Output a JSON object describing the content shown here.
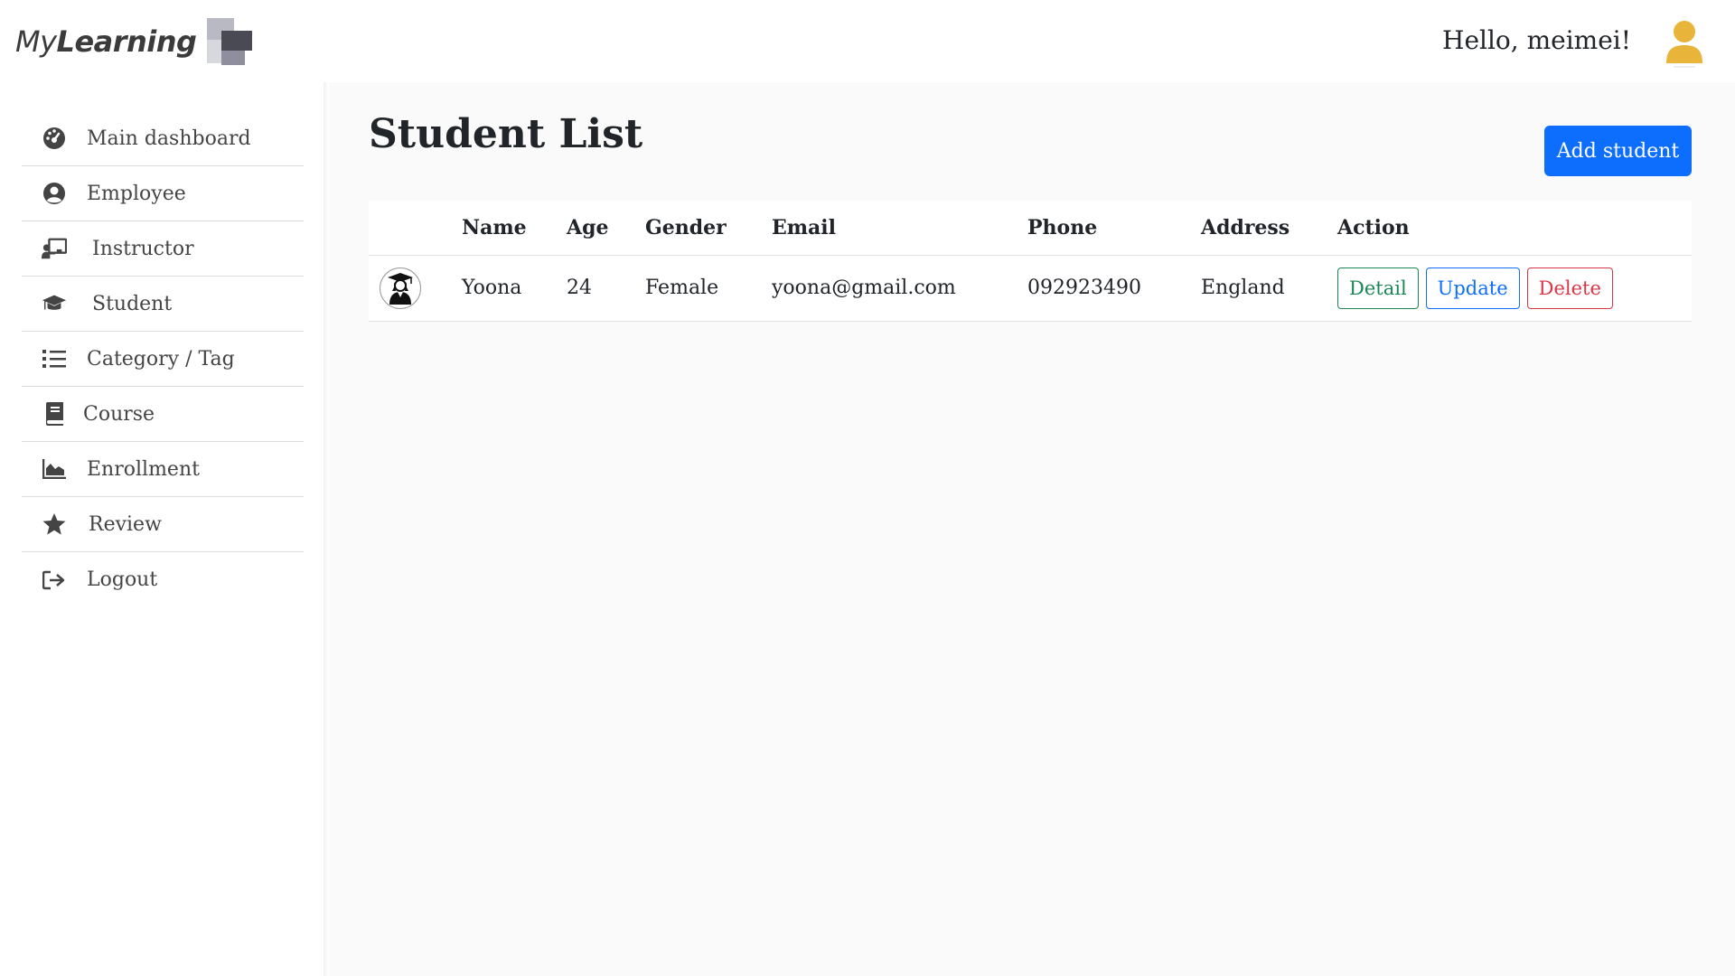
{
  "header": {
    "logo_text_light": "My",
    "logo_text_bold": "Learning",
    "greeting": "Hello, meimei!",
    "avatar_icon": "user-icon",
    "avatar_color": "#e8b53a"
  },
  "sidebar": {
    "items": [
      {
        "label": "Main dashboard",
        "icon": "dashboard-gauge-icon"
      },
      {
        "label": "Employee",
        "icon": "user-circle-icon"
      },
      {
        "label": "Instructor",
        "icon": "chalkboard-teacher-icon"
      },
      {
        "label": "Student",
        "icon": "graduation-cap-icon"
      },
      {
        "label": "Category / Tag",
        "icon": "list-icon"
      },
      {
        "label": "Course",
        "icon": "book-icon"
      },
      {
        "label": "Enrollment",
        "icon": "area-chart-icon"
      },
      {
        "label": "Review",
        "icon": "star-icon"
      },
      {
        "label": "Logout",
        "icon": "sign-out-icon"
      }
    ]
  },
  "main": {
    "title": "Student List",
    "add_button": "Add student",
    "table": {
      "headers": [
        "",
        "Name",
        "Age",
        "Gender",
        "Email",
        "Phone",
        "Address",
        "Action"
      ],
      "rows": [
        {
          "avatar_icon": "student-graduate-icon",
          "name": "Yoona",
          "age": "24",
          "gender": "Female",
          "email": "yoona@gmail.com",
          "phone": "092923490",
          "address": "England",
          "actions": {
            "detail": "Detail",
            "update": "Update",
            "delete": "Delete"
          }
        }
      ]
    }
  },
  "colors": {
    "primary": "#0d6efd",
    "success": "#198754",
    "danger": "#dc3545"
  }
}
